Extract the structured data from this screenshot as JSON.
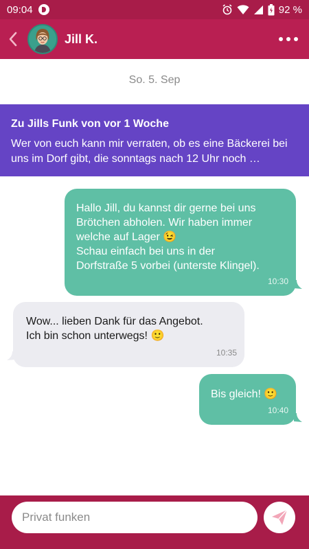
{
  "status_bar": {
    "time": "09:04",
    "battery": "92 %"
  },
  "header": {
    "contact_name": "Jill K."
  },
  "chat": {
    "date_separator": "So. 5. Sep",
    "reference": {
      "title": "Zu Jills Funk von vor 1 Woche",
      "text": "Wer von euch kann mir verraten, ob es eine Bäckerei bei uns im Dorf gibt, die sonntags nach 12 Uhr noch …"
    },
    "messages": [
      {
        "direction": "outgoing",
        "lines": [
          "Hallo Jill, du kannst dir gerne bei uns",
          "Brötchen abholen. Wir haben immer",
          "welche auf Lager 😉",
          "Schau einfach bei uns in der",
          "Dorfstraße 5 vorbei (unterste Klingel)."
        ],
        "time": "10:30"
      },
      {
        "direction": "incoming",
        "lines": [
          "Wow... lieben Dank für das Angebot.",
          "Ich bin schon unterwegs! 🙂"
        ],
        "time": "10:35"
      },
      {
        "direction": "outgoing",
        "lines": [
          "Bis gleich! 🙂"
        ],
        "time": "10:40"
      }
    ]
  },
  "composer": {
    "placeholder": "Privat funken",
    "value": ""
  },
  "colors": {
    "header": "#b91f52",
    "status_bar": "#a81c49",
    "reference_banner": "#6544c5",
    "outgoing_bubble": "#5fbfa5",
    "incoming_bubble": "#ececf1"
  },
  "icons": {
    "back": "chevron-left-icon",
    "more": "more-horizontal-icon",
    "send": "paper-plane-icon"
  }
}
